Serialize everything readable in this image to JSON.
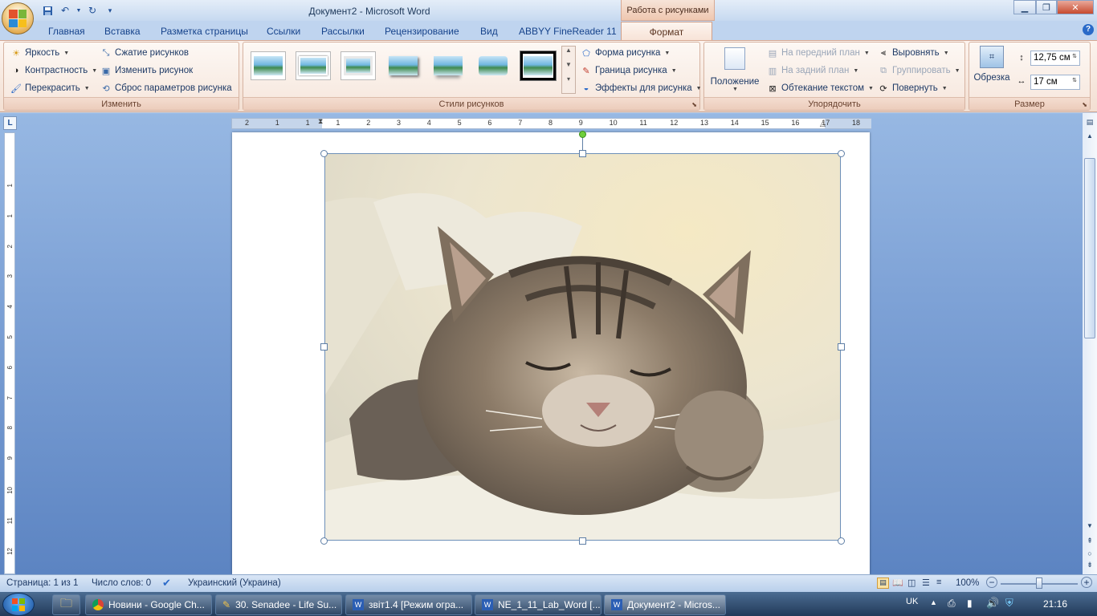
{
  "window": {
    "title": "Документ2 - Microsoft Word",
    "context_tab": "Работа с рисунками"
  },
  "tabs": [
    "Главная",
    "Вставка",
    "Разметка страницы",
    "Ссылки",
    "Рассылки",
    "Рецензирование",
    "Вид",
    "ABBYY FineReader 11",
    "Формат"
  ],
  "ribbon": {
    "adjust": {
      "label": "Изменить",
      "brightness": "Яркость",
      "contrast": "Контрастность",
      "recolor": "Перекрасить",
      "compress": "Сжатие рисунков",
      "change": "Изменить рисунок",
      "reset": "Сброс параметров рисунка"
    },
    "styles": {
      "label": "Стили рисунков",
      "shape": "Форма рисунка",
      "border": "Граница рисунка",
      "effects": "Эффекты для рисунка"
    },
    "arrange": {
      "label": "Упорядочить",
      "position": "Положение",
      "bring_front": "На передний план",
      "send_back": "На задний план",
      "wrap": "Обтекание текстом",
      "align": "Выровнять",
      "group": "Группировать",
      "rotate": "Повернуть"
    },
    "size": {
      "label": "Размер",
      "crop": "Обрезка",
      "height": "12,75 см",
      "width": "17 см"
    }
  },
  "ruler": {
    "h_ticks": [
      "2",
      "1",
      "1",
      "1",
      "2",
      "3",
      "4",
      "5",
      "6",
      "7",
      "8",
      "9",
      "10",
      "11",
      "12",
      "13",
      "14",
      "15",
      "16",
      "17",
      "18"
    ],
    "v_ticks": [
      "1",
      "1",
      "2",
      "3",
      "4",
      "5",
      "6",
      "7",
      "8",
      "9",
      "10",
      "11",
      "12",
      "13"
    ]
  },
  "status": {
    "page": "Страница: 1 из 1",
    "words": "Число слов: 0",
    "language": "Украинский (Украина)",
    "zoom": "100%"
  },
  "taskbar": {
    "items": [
      "Новини - Google Ch...",
      "30. Senadee - Life Su...",
      "звіт1.4 [Режим огра...",
      "NE_1_11_Lab_Word [...",
      "Документ2 - Micros..."
    ],
    "lang": "UK",
    "time": "21:16"
  },
  "colors": {
    "ribbon_context": "#f7e2d6",
    "workspace": "#7ea2d6",
    "accent": "#15428b"
  }
}
